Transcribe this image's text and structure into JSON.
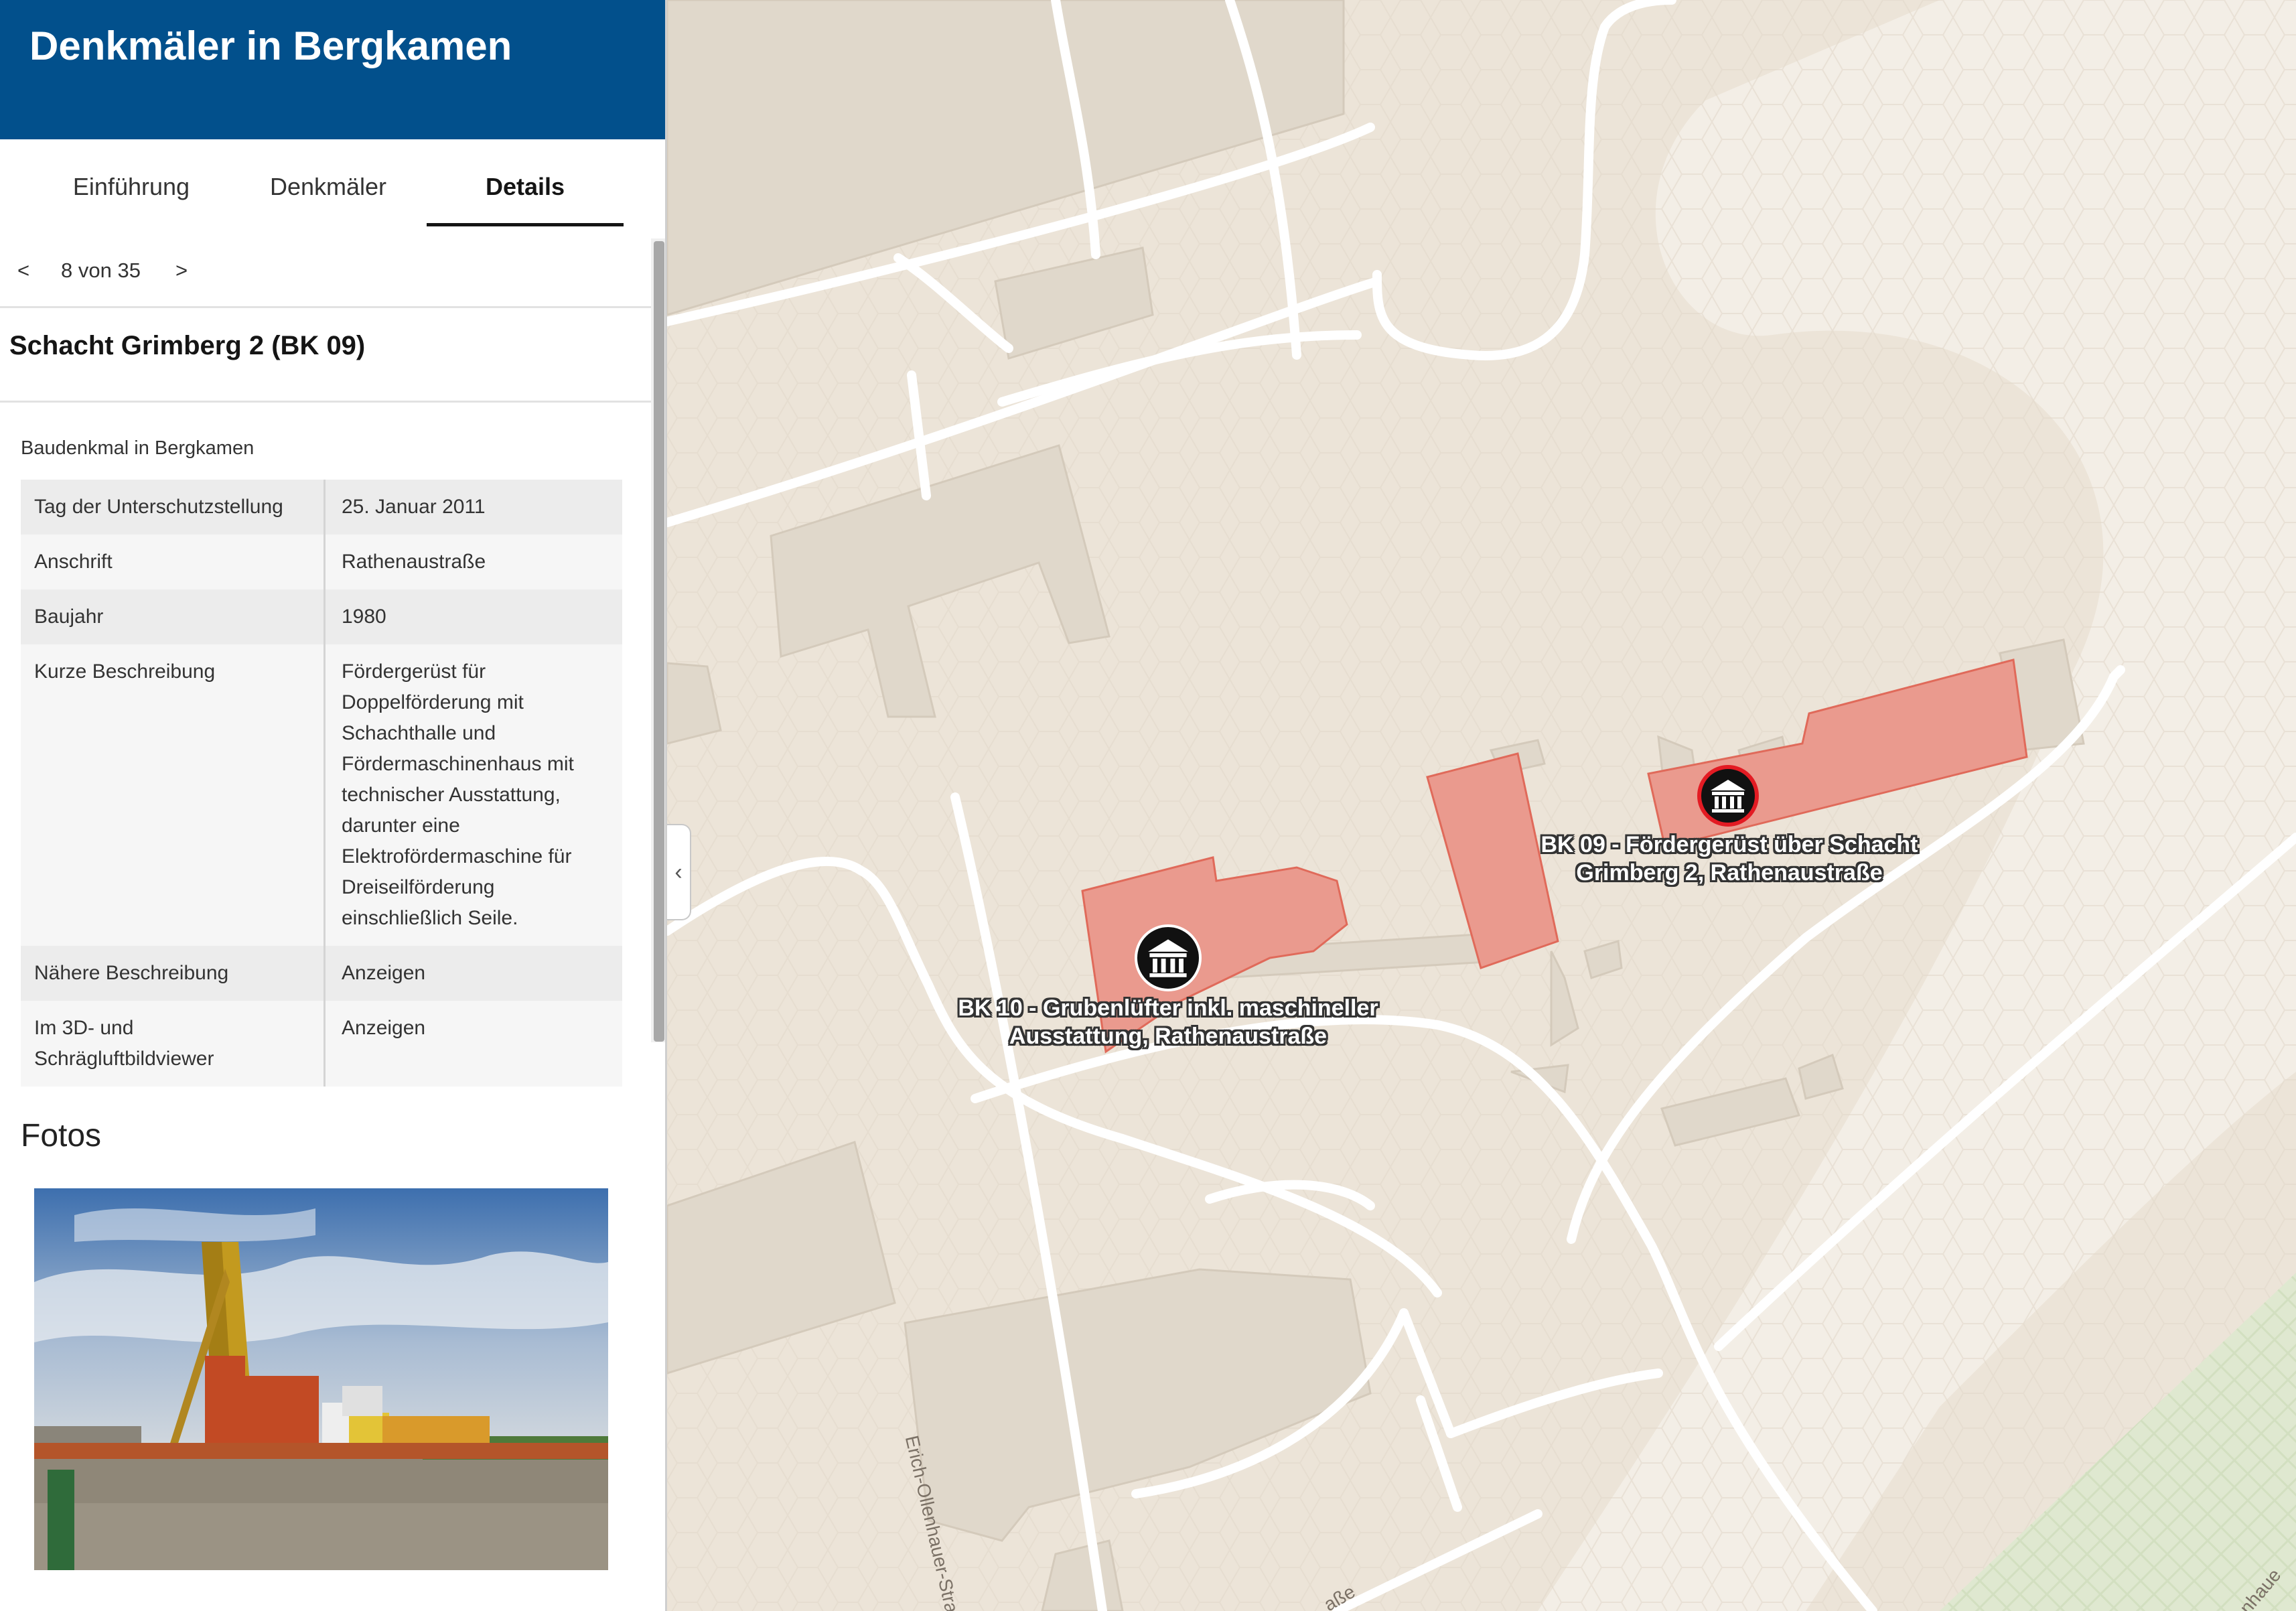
{
  "app": {
    "title": "Denkmäler in Bergkamen"
  },
  "tabs": [
    {
      "label": "Einführung",
      "active": false
    },
    {
      "label": "Denkmäler",
      "active": false
    },
    {
      "label": "Details",
      "active": true
    }
  ],
  "pager": {
    "prev": "<",
    "count": "8 von 35",
    "next": ">"
  },
  "feature": {
    "title": "Schacht Grimberg 2 (BK 09)",
    "subtitle": "Baudenkmal in Bergkamen",
    "attributes": [
      {
        "key": "Tag der Unterschutzstellung",
        "value": "25. Januar 2011"
      },
      {
        "key": "Anschrift",
        "value": "Rathenaustraße"
      },
      {
        "key": "Baujahr",
        "value": "1980"
      },
      {
        "key": "Kurze Beschreibung",
        "value": "Fördergerüst für Doppelförderung mit Schachthalle und Fördermaschinenhaus mit technischer Ausstattung, darunter eine Elektrofördermaschine für Dreiseilförderung einschließlich Seile."
      },
      {
        "key": "Nähere Beschreibung",
        "value": "Anzeigen"
      },
      {
        "key": "Im 3D- und Schrägluftbildviewer",
        "value": "Anzeigen"
      }
    ],
    "photos_heading": "Fotos"
  },
  "map": {
    "labels": {
      "bk09_line1": "BK 09 - Fördergerüst über Schacht",
      "bk09_line2": "Grimberg 2, Rathenaustraße",
      "bk10_line1": "BK 10 - Grubenlüfter inkl. maschineller",
      "bk10_line2": "Ausstattung, Rathenaustraße"
    },
    "streets": {
      "erich": "Erich-Ollenhauer-Straße",
      "bottom": "aße",
      "corner": "nhaue"
    },
    "colors": {
      "monument_fill": "#ea9a8e",
      "monument_stroke": "#e06a5a",
      "header": "#02508c",
      "background": "#ece4d8"
    },
    "icons": {
      "monument": "museum-icon"
    }
  }
}
